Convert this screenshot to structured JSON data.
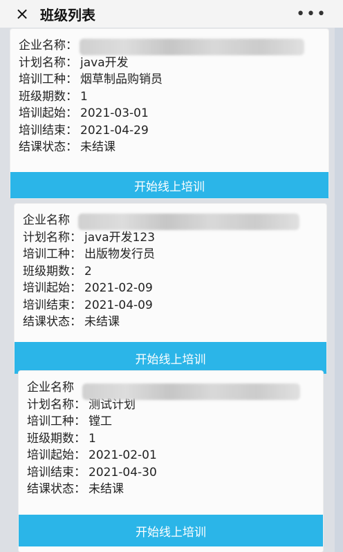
{
  "header": {
    "close_icon": "×",
    "title": "班级列表",
    "more_icon": "•••"
  },
  "classes": [
    {
      "company_label": "企业名称：",
      "plan_label": "计划名称：",
      "plan_value": "java开发",
      "trade_label": "培训工种：",
      "trade_value": "烟草制品购销员",
      "period_label": "班级期数：",
      "period_value": "1",
      "start_label": "培训起始：",
      "start_value": "2021-03-01",
      "end_label": "培训结束：",
      "end_value": "2021-04-29",
      "status_label": "结课状态：",
      "status_value": "未结课",
      "button_label": "开始线上培训"
    },
    {
      "company_label": "企业名称",
      "plan_label": "计划名称：",
      "plan_value": "java开发123",
      "trade_label": "培训工种：",
      "trade_value": "出版物发行员",
      "period_label": "班级期数：",
      "period_value": "2",
      "start_label": "培训起始：",
      "start_value": "2021-02-09",
      "end_label": "培训结束：",
      "end_value": "2021-04-09",
      "status_label": "结课状态：",
      "status_value": "未结课",
      "button_label": "开始线上培训"
    },
    {
      "company_label": "企业名称",
      "plan_label": "计划名称：",
      "plan_value": "测试计划",
      "trade_label": "培训工种：",
      "trade_value": "镗工",
      "period_label": "班级期数：",
      "period_value": "1",
      "start_label": "培训起始：",
      "start_value": "2021-02-01",
      "end_label": "培训结束：",
      "end_value": "2021-04-30",
      "status_label": "结课状态：",
      "status_value": "未结课",
      "button_label": "开始线上培训"
    }
  ]
}
